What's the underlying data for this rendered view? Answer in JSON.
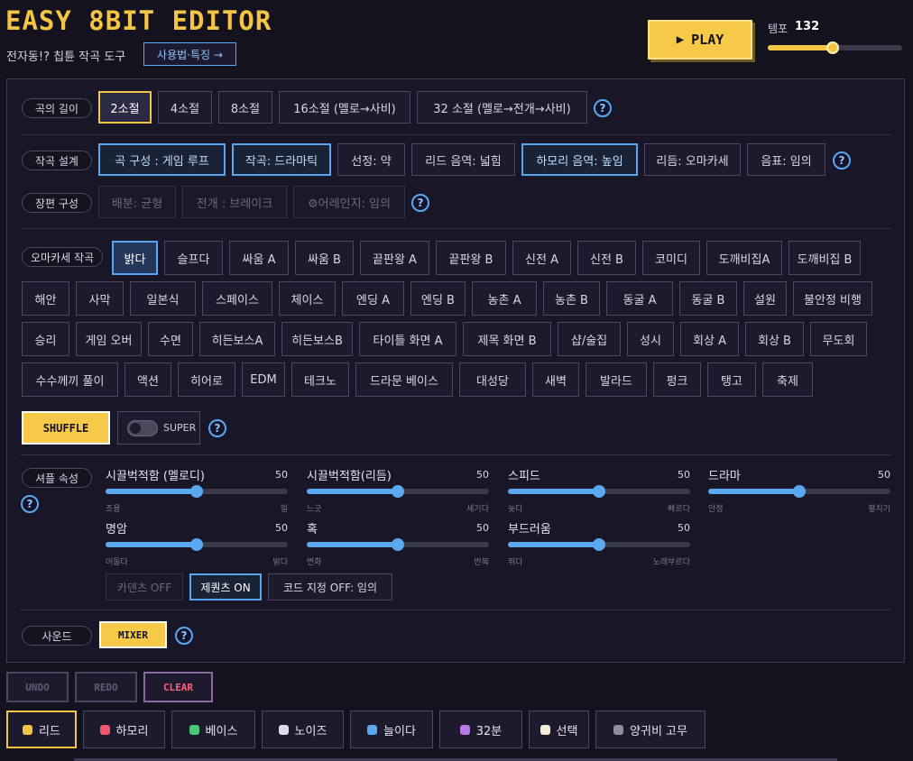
{
  "header": {
    "title": "EASY 8BIT EDITOR",
    "subtitle": "전자동!? 칩튠 작곡 도구",
    "usage_label": "사용법·특징 →",
    "play_label": "PLAY",
    "tempo_label": "템포",
    "tempo_value": "132",
    "tempo_level": 0.48
  },
  "length": {
    "label": "곡의 길이",
    "options": [
      "2소절",
      "4소절",
      "8소절",
      "16소절 (멜로→사비)",
      "32 소절 (멜로→전개→사비)"
    ],
    "selected": "2소절"
  },
  "design": {
    "label": "작곡 설계",
    "options": [
      "곡 구성 : 게임 루프",
      "작곡: 드라마틱",
      "선정: 약",
      "리드 음역: 넓힘",
      "하모리 음역: 높임",
      "리듬: 오마카세",
      "음표: 임의"
    ]
  },
  "longform": {
    "label": "장편 구성",
    "options": [
      "배분: 균형",
      "전개 : 브레이크",
      "⚙어레인지: 임의"
    ]
  },
  "omakase": {
    "label": "오마카세 작곡",
    "rows": [
      [
        "밝다",
        "슬프다",
        "싸움 A",
        "싸움 B",
        "끝판왕 A",
        "끝판왕 B",
        "신전 A",
        "신전 B",
        "코미디",
        "도깨비집A",
        "도깨비집 B"
      ],
      [
        "해안",
        "사막",
        "일본식",
        "스페이스",
        "체이스",
        "엔딩 A",
        "엔딩 B",
        "농촌 A",
        "농촌 B",
        "동굴 A",
        "동굴 B",
        "설원",
        "불안정 비행"
      ],
      [
        "승리",
        "게임 오버",
        "수면",
        "히든보스A",
        "히든보스B",
        "타이틀 화면 A",
        "제목 화면 B",
        "샵/술집",
        "성시",
        "회상 A",
        "회상 B",
        "무도회"
      ],
      [
        "수수께끼 풀이",
        "액션",
        "히어로",
        "EDM",
        "테크노",
        "드라문 베이스",
        "대성당",
        "새벽",
        "발라드",
        "펑크",
        "탱고",
        "축제"
      ]
    ],
    "selected": "밝다"
  },
  "shuffle": {
    "label": "SHUFFLE",
    "super_label": "SUPER"
  },
  "props": {
    "label": "셔플 속성",
    "sliders": [
      {
        "label": "시끌벅적함 (멜로디)",
        "value": "50",
        "min": "조용",
        "max": "밀"
      },
      {
        "label": "시끌벅적함(리듬)",
        "value": "50",
        "min": "느긋",
        "max": "세기다"
      },
      {
        "label": "스피드",
        "value": "50",
        "min": "늦다",
        "max": "빠르다"
      },
      {
        "label": "드라마",
        "value": "50",
        "min": "안정",
        "max": "펼치기"
      },
      {
        "label": "명암",
        "value": "50",
        "min": "어둡다",
        "max": "밝다"
      },
      {
        "label": "혹",
        "value": "50",
        "min": "변화",
        "max": "반복"
      },
      {
        "label": "부드러움",
        "value": "50",
        "min": "뛰다",
        "max": "노래부르다"
      }
    ],
    "toggles": [
      "카덴츠 OFF",
      "제퀀츠 ON",
      "코드 지정 OFF: 임의"
    ]
  },
  "sound": {
    "label": "사운드",
    "mixer_label": "MIXER"
  },
  "actions": [
    "UNDO",
    "REDO",
    "CLEAR"
  ],
  "tracks": [
    {
      "label": "리드",
      "color": "#f4c542"
    },
    {
      "label": "하모리",
      "color": "#f2566c"
    },
    {
      "label": "베이스",
      "color": "#4cc77a"
    },
    {
      "label": "노이즈",
      "color": "#dcdcec"
    },
    {
      "label": "늘이다",
      "color": "#5aa8f0"
    },
    {
      "label": "32분",
      "color": "#b67be8"
    },
    {
      "label": "선택",
      "color": "#f5ecd9"
    },
    {
      "label": "양귀비 고무",
      "color": "#8d8d99"
    }
  ],
  "help_glyph": "?"
}
